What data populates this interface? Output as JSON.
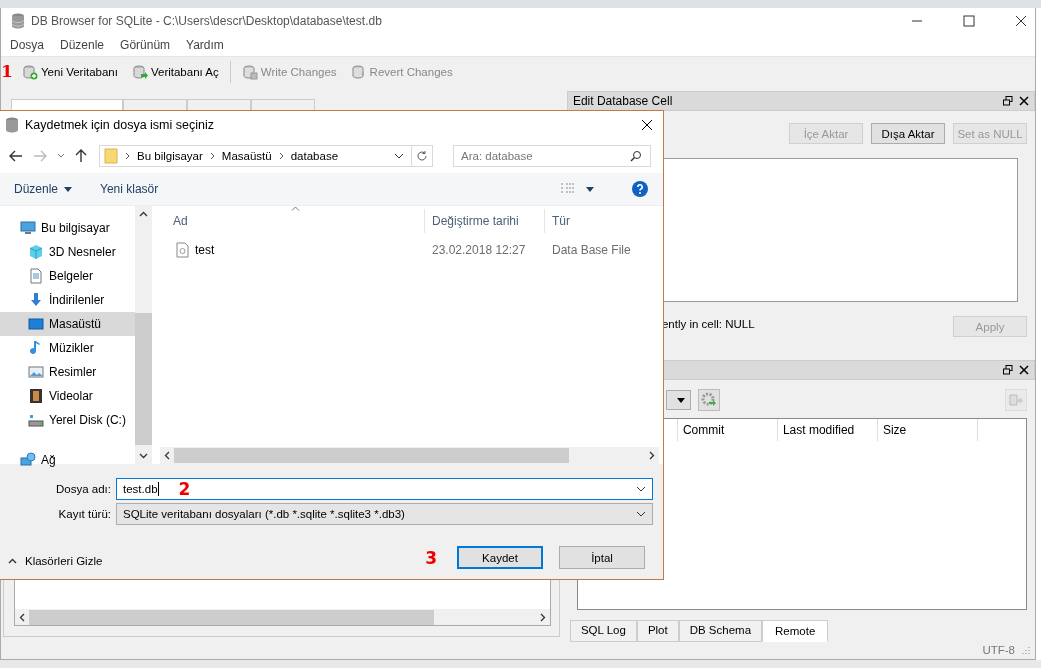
{
  "window": {
    "title": "DB Browser for SQLite - C:\\Users\\descr\\Desktop\\database\\test.db"
  },
  "menu": [
    "Dosya",
    "Düzenle",
    "Görünüm",
    "Yardım"
  ],
  "toolbar_marker": "1",
  "toolbar": [
    {
      "label": "Yeni Veritabanı",
      "kind": "new",
      "disabled": false
    },
    {
      "label": "Veritabanı Aç",
      "kind": "open",
      "disabled": false
    },
    {
      "label": "Write Changes",
      "kind": "write",
      "disabled": true
    },
    {
      "label": "Revert Changes",
      "kind": "revert",
      "disabled": true
    }
  ],
  "edit_cell": {
    "title": "Edit Database Cell",
    "buttons": [
      {
        "label": "İçe Aktar",
        "disabled": true
      },
      {
        "label": "Dışa Aktar",
        "disabled": false
      },
      {
        "label": "Set as NULL",
        "disabled": true
      }
    ],
    "info": "ently in cell: NULL",
    "apply": {
      "label": "Apply",
      "disabled": true
    }
  },
  "remote": {
    "columns": [
      "Commit",
      "Last modified",
      "Size"
    ]
  },
  "bottom_tabs": [
    {
      "label": "SQL Log",
      "selected": false
    },
    {
      "label": "Plot",
      "selected": false
    },
    {
      "label": "DB Schema",
      "selected": false
    },
    {
      "label": "Remote",
      "selected": true
    }
  ],
  "status_bar": {
    "encoding": "UTF-8"
  },
  "dialog": {
    "title": "Kaydetmek için dosya ismi seçiniz",
    "breadcrumb": [
      "Bu bilgisayar",
      "Masaüstü",
      "database"
    ],
    "search": {
      "placeholder": "Ara: database"
    },
    "organize": "Düzenle",
    "new_folder": "Yeni klasör",
    "nav": [
      {
        "label": "Bu bilgisayar",
        "kind": "pc",
        "selected": false,
        "children": [
          {
            "label": "3D Nesneler",
            "kind": "cube",
            "selected": false
          },
          {
            "label": "Belgeler",
            "kind": "doc",
            "selected": false
          },
          {
            "label": "İndirilenler",
            "kind": "download",
            "selected": false
          },
          {
            "label": "Masaüstü",
            "kind": "desktop",
            "selected": true
          },
          {
            "label": "Müzikler",
            "kind": "music",
            "selected": false
          },
          {
            "label": "Resimler",
            "kind": "image",
            "selected": false
          },
          {
            "label": "Videolar",
            "kind": "video",
            "selected": false
          },
          {
            "label": "Yerel Disk (C:)",
            "kind": "disk",
            "selected": false
          }
        ]
      },
      {
        "label": "Ağ",
        "kind": "network",
        "selected": false
      }
    ],
    "files": {
      "columns": [
        "Ad",
        "Değiştirme tarihi",
        "Tür"
      ],
      "rows": [
        {
          "name": "test",
          "date": "23.02.2018 12:27",
          "type": "Data Base File"
        }
      ]
    },
    "filename": {
      "label": "Dosya adı:",
      "value": "test.db"
    },
    "filename_marker": "2",
    "filetype": {
      "label": "Kayıt türü:",
      "value": "SQLite veritabanı dosyaları (*.db *.sqlite *.sqlite3 *.db3)"
    },
    "toggle": "Klasörleri Gizle",
    "save_marker": "3",
    "save": "Kaydet",
    "cancel": "İptal"
  }
}
